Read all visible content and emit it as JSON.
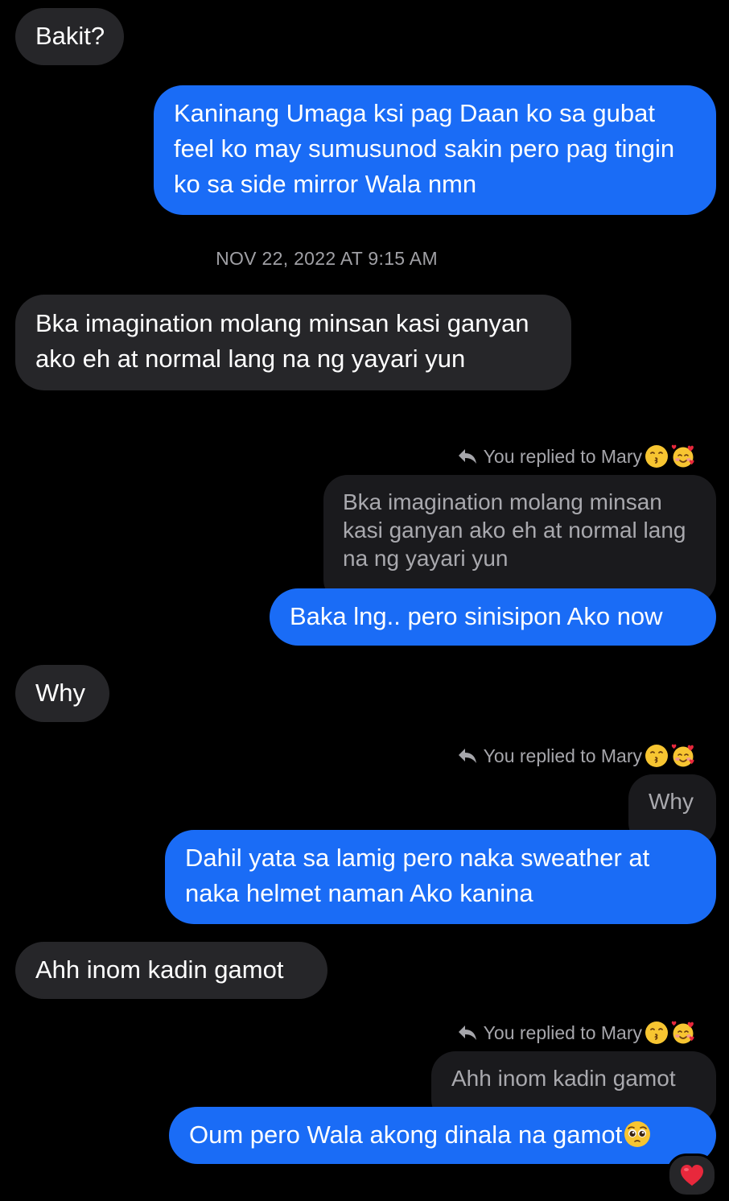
{
  "messages": [
    {
      "text": "Bakit?"
    },
    {
      "text": "Kaninang Umaga ksi pag Daan ko sa gubat feel ko may sumusunod sakin pero pag tingin ko sa side mirror Wala nmn"
    },
    {
      "text": "Bka imagination molang minsan kasi ganyan ako eh at normal lang na ng yayari yun"
    },
    {
      "text": "Baka lng.. pero sinisipon Ako now"
    },
    {
      "text": "Why"
    },
    {
      "text": "Dahil yata sa lamig pero naka sweather at naka helmet naman Ako kanina"
    },
    {
      "text": "Ahh inom kadin gamot"
    },
    {
      "text": "Oum pero Wala akong dinala na gamot"
    }
  ],
  "timestamp": "NOV 22, 2022 AT 9:15 AM",
  "replies": [
    {
      "label": "You replied to Mary",
      "quote": "Bka imagination molang minsan kasi ganyan ako eh at normal lang na ng yayari yun"
    },
    {
      "label": "You replied to Mary",
      "quote": "Why"
    },
    {
      "label": "You replied to Mary",
      "quote": "Ahh inom kadin gamot"
    }
  ],
  "icons": {
    "reply": "reply-arrow-icon",
    "name_emojis": [
      "kissing-face-icon",
      "smiling-face-with-hearts-icon"
    ],
    "inline_emoji": "pleading-face-icon",
    "reaction": "red-heart-icon"
  },
  "colors": {
    "background": "#000000",
    "received_bubble": "#262629",
    "sent_bubble": "#1a6cf6",
    "quoted_bubble": "#1a1a1d",
    "reaction_heart": "#e8283c"
  }
}
